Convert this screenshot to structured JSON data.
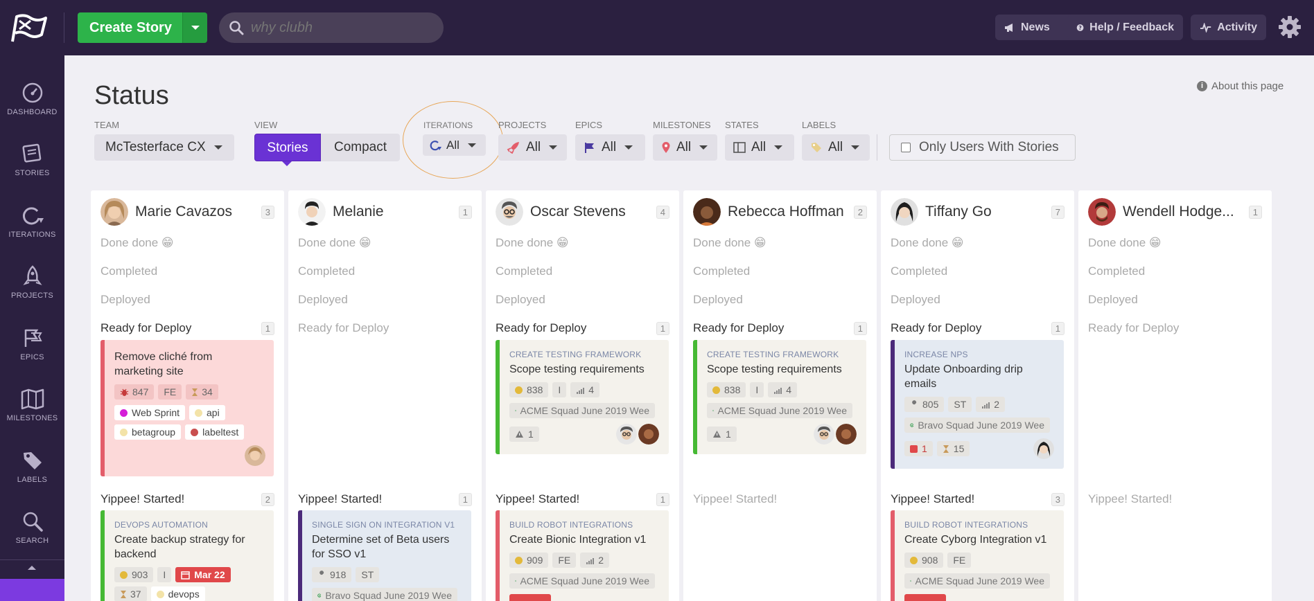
{
  "topbar": {
    "create_label": "Create Story",
    "search_placeholder": "why clubh",
    "news": "News",
    "help": "Help / Feedback",
    "activity": "Activity"
  },
  "sidebar": {
    "items": [
      {
        "label": "DASHBOARD",
        "icon": "dashboard-icon"
      },
      {
        "label": "STORIES",
        "icon": "stories-icon"
      },
      {
        "label": "ITERATIONS",
        "icon": "iterations-icon"
      },
      {
        "label": "PROJECTS",
        "icon": "rocket-icon"
      },
      {
        "label": "EPICS",
        "icon": "flags-icon"
      },
      {
        "label": "MILESTONES",
        "icon": "map-icon"
      },
      {
        "label": "LABELS",
        "icon": "tag-icon"
      },
      {
        "label": "SEARCH",
        "icon": "search-icon"
      }
    ]
  },
  "page": {
    "title": "Status",
    "about": "About this page"
  },
  "filters": {
    "team": {
      "label": "TEAM",
      "value": "McTesterface CX"
    },
    "view": {
      "label": "VIEW",
      "stories": "Stories",
      "compact": "Compact"
    },
    "iterations": {
      "label": "ITERATIONS",
      "value": "All"
    },
    "projects": {
      "label": "PROJECTS",
      "value": "All"
    },
    "epics": {
      "label": "EPICS",
      "value": "All"
    },
    "milestones": {
      "label": "MILESTONES",
      "value": "All"
    },
    "states": {
      "label": "STATES",
      "value": "All"
    },
    "labels": {
      "label": "LABELS",
      "value": "All"
    },
    "only_users": "Only Users With Stories"
  },
  "states": {
    "done": "Done done 😁",
    "completed": "Completed",
    "deployed": "Deployed",
    "ready": "Ready for Deploy",
    "started": "Yippee! Started!"
  },
  "colors": {
    "accent": "#6a32d4",
    "create": "#2db34a",
    "topbar": "#2b2040",
    "highlight_circle": "#e7a657"
  },
  "columns": [
    {
      "name": "Marie Cavazos",
      "count": "3",
      "ready_count": "1",
      "started_count": "2",
      "ready_card": {
        "title": "Remove cliché from marketing site",
        "id": "847",
        "type": "FE",
        "estimate": "34",
        "labels": [
          "Web Sprint",
          "api",
          "betagroup",
          "labeltest"
        ]
      },
      "started_card": {
        "epic": "DEVOPS AUTOMATION",
        "title": "Create backup strategy for backend",
        "id": "903",
        "type": "I",
        "date": "Mar 22",
        "estimate": "37",
        "label": "devops"
      }
    },
    {
      "name": "Melanie",
      "count": "1",
      "started_count": "1",
      "started_card": {
        "epic": "SINGLE SIGN ON INTEGRATION V1",
        "title": "Determine set of Beta users for SSO v1",
        "id": "918",
        "type": "ST",
        "iteration": "Bravo Squad June 2019 Wee"
      }
    },
    {
      "name": "Oscar Stevens",
      "count": "4",
      "ready_count": "1",
      "started_count": "1",
      "ready_card": {
        "epic": "CREATE TESTING FRAMEWORK",
        "title": "Scope testing requirements",
        "id": "838",
        "type": "I",
        "estimate": "4",
        "iteration": "ACME Squad June 2019 Wee",
        "warnings": "1"
      },
      "started_card": {
        "epic": "BUILD ROBOT INTEGRATIONS",
        "title": "Create Bionic Integration v1",
        "id": "909",
        "type": "FE",
        "estimate": "2",
        "iteration": "ACME Squad June 2019 Wee"
      }
    },
    {
      "name": "Rebecca Hoffman",
      "count": "2",
      "ready_count": "1",
      "ready_card": {
        "epic": "CREATE TESTING FRAMEWORK",
        "title": "Scope testing requirements",
        "id": "838",
        "type": "I",
        "estimate": "4",
        "iteration": "ACME Squad June 2019 Wee",
        "warnings": "1"
      }
    },
    {
      "name": "Tiffany Go",
      "count": "7",
      "ready_count": "1",
      "started_count": "3",
      "ready_card": {
        "epic": "INCREASE NPS",
        "title": "Update Onboarding drip emails",
        "id": "805",
        "type": "ST",
        "estimate": "2",
        "iteration": "Bravo Squad June 2019 Wee",
        "blockers": "1",
        "hours": "15"
      },
      "started_card": {
        "epic": "BUILD ROBOT INTEGRATIONS",
        "title": "Create Cyborg Integration v1",
        "id": "908",
        "type": "FE",
        "iteration": "ACME Squad June 2019 Wee"
      }
    },
    {
      "name": "Wendell Hodge...",
      "count": "1"
    }
  ]
}
